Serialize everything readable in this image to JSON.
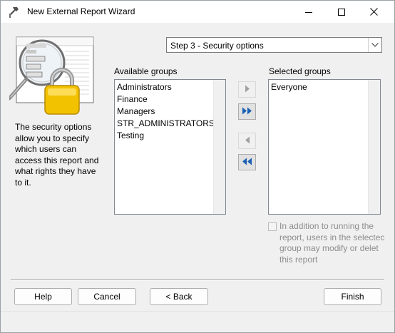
{
  "window": {
    "title": "New External Report Wizard",
    "minimize_icon": "minimize-icon",
    "maximize_icon": "maximize-icon",
    "close_icon": "close-icon"
  },
  "step": {
    "selected": "Step 3 - Security options"
  },
  "description": "The security options allow you to specify which users can access this report and what rights they have to it.",
  "available": {
    "label": "Available groups",
    "items": [
      "Administrators",
      "Finance",
      "Managers",
      "STR_ADMINISTRATORS",
      "Testing"
    ]
  },
  "selected": {
    "label": "Selected groups",
    "items": [
      "Everyone"
    ]
  },
  "move_buttons": {
    "add_one_icon": "arrow-right-icon",
    "add_all_icon": "double-arrow-right-icon",
    "remove_one_icon": "arrow-left-icon",
    "remove_all_icon": "double-arrow-left-icon"
  },
  "modify_option": {
    "checked": false,
    "enabled": false,
    "lines": [
      "In addition to running the",
      "report, users in the selectec",
      "group may modify or delet",
      "this report"
    ]
  },
  "buttons": {
    "help": "Help",
    "cancel": "Cancel",
    "back": "< Back",
    "finish": "Finish"
  },
  "colors": {
    "accent_blue": "#1a5fb4",
    "disabled_text": "#8d8d8d",
    "lock_gold": "#f2c200"
  }
}
